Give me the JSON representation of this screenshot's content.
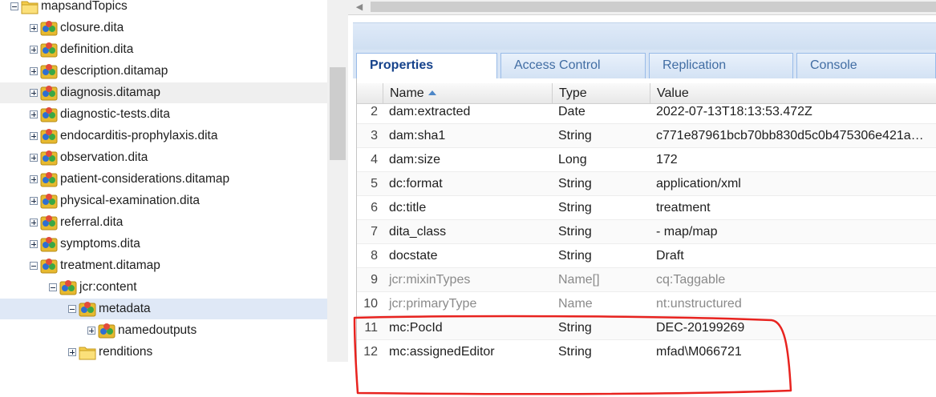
{
  "tree": {
    "items": [
      {
        "label": "mapsandTopics",
        "icon": "folder-icon",
        "expander": "minus"
      },
      {
        "label": "closure.dita",
        "icon": "node-icon",
        "expander": "plus"
      },
      {
        "label": "definition.dita",
        "icon": "node-icon",
        "expander": "plus"
      },
      {
        "label": "description.ditamap",
        "icon": "node-icon",
        "expander": "plus"
      },
      {
        "label": "diagnosis.ditamap",
        "icon": "node-icon",
        "expander": "plus"
      },
      {
        "label": "diagnostic-tests.dita",
        "icon": "node-icon",
        "expander": "plus"
      },
      {
        "label": "endocarditis-prophylaxis.dita",
        "icon": "node-icon",
        "expander": "plus"
      },
      {
        "label": "observation.dita",
        "icon": "node-icon",
        "expander": "plus"
      },
      {
        "label": "patient-considerations.ditamap",
        "icon": "node-icon",
        "expander": "plus"
      },
      {
        "label": "physical-examination.dita",
        "icon": "node-icon",
        "expander": "plus"
      },
      {
        "label": "referral.dita",
        "icon": "node-icon",
        "expander": "plus"
      },
      {
        "label": "symptoms.dita",
        "icon": "node-icon",
        "expander": "plus"
      },
      {
        "label": "treatment.ditamap",
        "icon": "node-icon",
        "expander": "minus"
      },
      {
        "label": "jcr:content",
        "icon": "node-icon",
        "expander": "minus"
      },
      {
        "label": "metadata",
        "icon": "node-icon",
        "expander": "minus"
      },
      {
        "label": "namedoutputs",
        "icon": "node-icon",
        "expander": "plus"
      },
      {
        "label": "renditions",
        "icon": "folder-icon",
        "expander": "plus"
      }
    ]
  },
  "tabs": [
    {
      "label": "Properties",
      "active": true
    },
    {
      "label": "Access Control",
      "active": false
    },
    {
      "label": "Replication",
      "active": false
    },
    {
      "label": "Console",
      "active": false
    }
  ],
  "grid": {
    "columns": {
      "name": "Name",
      "type": "Type",
      "value": "Value"
    },
    "rows": [
      {
        "num": "2",
        "name": "dam:extracted",
        "type": "Date",
        "value": "2022-07-13T18:13:53.472Z"
      },
      {
        "num": "3",
        "name": "dam:sha1",
        "type": "String",
        "value": "c771e87961bcb70bb830d5c0b475306e421a…"
      },
      {
        "num": "4",
        "name": "dam:size",
        "type": "Long",
        "value": "172"
      },
      {
        "num": "5",
        "name": "dc:format",
        "type": "String",
        "value": "application/xml"
      },
      {
        "num": "6",
        "name": "dc:title",
        "type": "String",
        "value": "treatment"
      },
      {
        "num": "7",
        "name": "dita_class",
        "type": "String",
        "value": "- map/map"
      },
      {
        "num": "8",
        "name": "docstate",
        "type": "String",
        "value": "Draft"
      },
      {
        "num": "9",
        "name": "jcr:mixinTypes",
        "type": "Name[]",
        "value": "cq:Taggable",
        "muted": true
      },
      {
        "num": "10",
        "name": "jcr:primaryType",
        "type": "Name",
        "value": "nt:unstructured",
        "muted": true
      },
      {
        "num": "11",
        "name": "mc:PocId",
        "type": "String",
        "value": "DEC-20199269"
      },
      {
        "num": "12",
        "name": "mc:assignedEditor",
        "type": "String",
        "value": "mfad\\M066721"
      }
    ]
  },
  "colors": {
    "annotation": "#e8231f",
    "tab_active_text": "#15428b",
    "tab_text": "#416da3",
    "selected_row": "#dfe8f6"
  }
}
